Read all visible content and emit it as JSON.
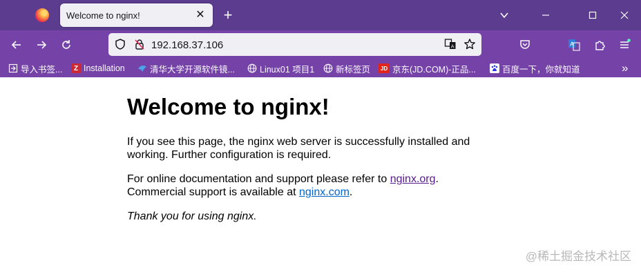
{
  "browser": {
    "tab_title": "Welcome to nginx!",
    "tab_close": "✕",
    "new_tab": "+",
    "url": "192.168.37.106",
    "window_controls": {
      "list": "⌄",
      "minimize": "—",
      "maximize": "☐",
      "close": "✕"
    },
    "nav_glyphs": {
      "back": "←",
      "forward": "→",
      "reload": "↻",
      "bookmarks_overflow": "»"
    }
  },
  "bookmarks": [
    {
      "label": "导入书签...",
      "icon": "import-icon"
    },
    {
      "label": "Installation",
      "icon": "zotero-icon",
      "icon_text": "Z"
    },
    {
      "label": "清华大学开源软件镜...",
      "icon": "tuna-icon"
    },
    {
      "label": "Linux01 项目1",
      "icon": "globe-icon"
    },
    {
      "label": "新标签页",
      "icon": "globe-icon"
    },
    {
      "label": "京东(JD.COM)-正品...",
      "icon": "jd-icon",
      "icon_text": "JD"
    },
    {
      "label": "百度一下，你就知道",
      "icon": "baidu-icon"
    }
  ],
  "page": {
    "heading": "Welcome to nginx!",
    "para1": "If you see this page, the nginx web server is successfully installed and working. Further configuration is required.",
    "para2_a": "For online documentation and support please refer to ",
    "link1": "nginx.org",
    "para2_b": ".",
    "para2_c": "Commercial support is available at ",
    "link2": "nginx.com",
    "para2_d": ".",
    "para3": "Thank you for using nginx."
  },
  "watermark": "@稀土掘金技术社区",
  "colors": {
    "tabbar_bg": "#5c3c8e",
    "toolbar_bg": "#7542a8",
    "visited_link": "#551a8b",
    "link": "#0066cc"
  }
}
